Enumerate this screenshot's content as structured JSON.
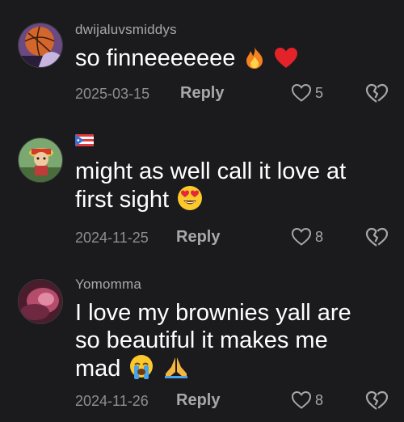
{
  "comments": [
    {
      "username": "dwijaluvsmiddys",
      "text": "so finneeeeeee",
      "emoji_names": [
        "fire-emoji",
        "red-heart-emoji"
      ],
      "date": "2025-03-15",
      "reply_label": "Reply",
      "likes": "5",
      "avatar": "basketball-avatar"
    },
    {
      "username": "",
      "flag": "puerto-rico-flag",
      "text_lines": [
        "might as well call it love at",
        "first sight"
      ],
      "emoji_names": [
        "heart-eyes-emoji"
      ],
      "date": "2024-11-25",
      "reply_label": "Reply",
      "likes": "8",
      "avatar": "cartoon-character-avatar"
    },
    {
      "username": "Yomomma",
      "text_lines": [
        "I love my brownies yall are",
        "so beautiful it makes me",
        "mad"
      ],
      "emoji_names": [
        "loudly-crying-emoji",
        "folded-hands-emoji"
      ],
      "date": "2024-11-26",
      "reply_label": "Reply",
      "likes": "8",
      "avatar": "pink-photo-avatar"
    }
  ],
  "colors": {
    "background": "#1b1b1d",
    "text": "#ffffff",
    "secondary": "#a8a8ac"
  }
}
